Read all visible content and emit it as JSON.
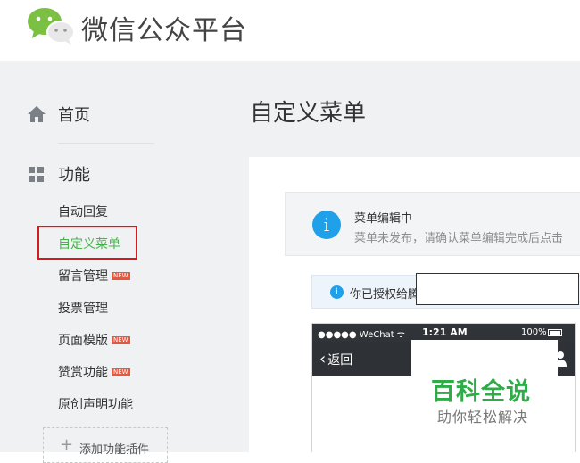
{
  "header": {
    "brand": "微信公众平台",
    "logo_icon": "wechat-logo-icon"
  },
  "sidebar": {
    "home_label": "首页",
    "function_label": "功能",
    "sub_items": [
      {
        "label": "自动回复",
        "new": false,
        "active": false
      },
      {
        "label": "自定义菜单",
        "new": false,
        "active": true
      },
      {
        "label": "留言管理",
        "new": true,
        "active": false
      },
      {
        "label": "投票管理",
        "new": false,
        "active": false
      },
      {
        "label": "页面模版",
        "new": true,
        "active": false
      },
      {
        "label": "赞赏功能",
        "new": true,
        "active": false
      },
      {
        "label": "原创声明功能",
        "new": false,
        "active": false
      }
    ],
    "new_badge_text": "NEW",
    "add_plugin_label": "添加功能插件",
    "add_plugin_icon": "+"
  },
  "main": {
    "title": "自定义菜单",
    "notice": {
      "icon_text": "i",
      "title": "菜单编辑中",
      "desc": "菜单未发布，请确认菜单编辑完成后点击"
    },
    "auth": {
      "icon_text": "i",
      "text": "你已授权给腾"
    }
  },
  "phone": {
    "carrier": "●●●●● WeChat ᯤ",
    "time": "1:21 AM",
    "battery": "100%",
    "back_label": "返回",
    "back_chevron": "‹"
  },
  "watermark": {
    "main": "百科全说",
    "sub": "助你轻松解决"
  },
  "colors": {
    "accent_green": "#44b549",
    "highlight_red": "#d5191f",
    "info_blue": "#20a0e8",
    "new_badge": "#e8563c"
  }
}
